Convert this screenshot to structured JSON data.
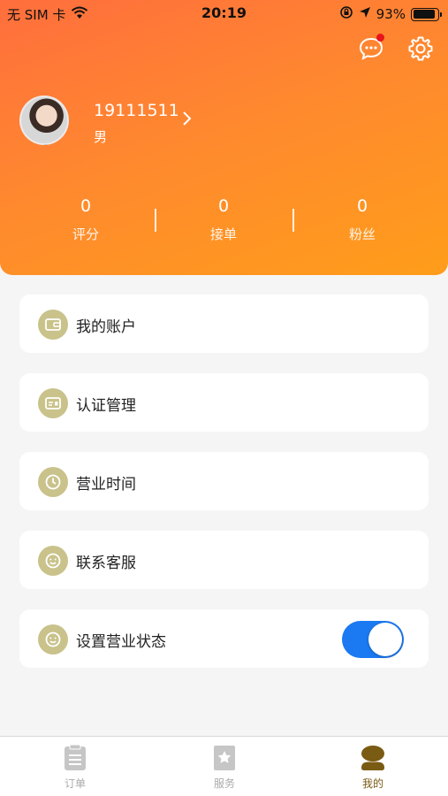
{
  "status_bar": {
    "carrier": "无 SIM 卡",
    "time": "20:19",
    "battery": "93%",
    "icons": [
      "wifi-icon",
      "orientation-lock-icon",
      "location-arrow-icon",
      "battery-icon"
    ]
  },
  "header": {
    "icons": [
      "message-bubble-icon",
      "gear-icon"
    ],
    "has_unread_message": true
  },
  "profile": {
    "username": "19111511",
    "gender": "男"
  },
  "stats": [
    {
      "value": "0",
      "label": "评分"
    },
    {
      "value": "0",
      "label": "接单"
    },
    {
      "value": "0",
      "label": "粉丝"
    }
  ],
  "menu": [
    {
      "label": "我的账户",
      "icon": "wallet-icon"
    },
    {
      "label": "认证管理",
      "icon": "id-card-icon"
    },
    {
      "label": "营业时间",
      "icon": "clock-icon"
    },
    {
      "label": "联系客服",
      "icon": "smiley-support-icon"
    },
    {
      "label": "设置营业状态",
      "icon": "smiley-status-icon",
      "toggle_on": true
    }
  ],
  "tabbar": [
    {
      "label": "订单",
      "icon": "order-list-icon",
      "active": false
    },
    {
      "label": "服务",
      "icon": "star-bookmark-icon",
      "active": false
    },
    {
      "label": "我的",
      "icon": "user-profile-icon",
      "active": true
    }
  ],
  "colors": {
    "header_gradient_start": "#ff6e3d",
    "header_gradient_end": "#ff9d1a",
    "menu_icon_bg": "#c9c28b",
    "toggle_on": "#1b79f2",
    "tab_active": "#7a5b13",
    "tab_inactive": "#aaaaaa",
    "badge_red": "#e8131d"
  }
}
